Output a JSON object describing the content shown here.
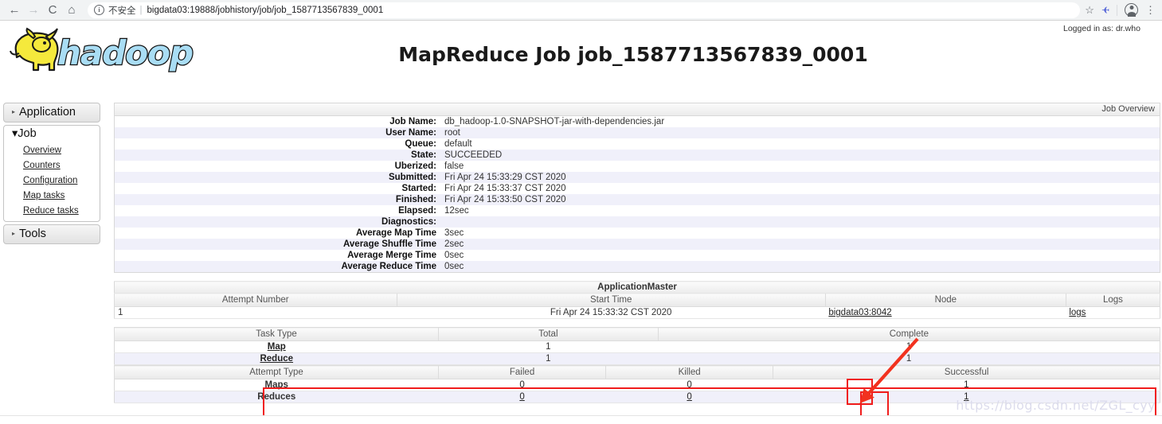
{
  "browser": {
    "back_icon": "←",
    "forward_icon": "→",
    "reload_icon": "C",
    "home_icon": "⌂",
    "security_label": "不安全",
    "separator": "|",
    "url": "bigdata03:19888/jobhistory/job/job_1587713567839_0001",
    "star_icon": "☆",
    "extension_icon": "✈",
    "menu_icon": "⋮"
  },
  "header": {
    "logo_text": "hadoop",
    "page_title": "MapReduce Job job_1587713567839_0001",
    "logged_in": "Logged in as: dr.who"
  },
  "sidebar": {
    "application": {
      "label": "Application",
      "arrow": "▸"
    },
    "job": {
      "label": "Job",
      "arrow": "▾",
      "items": [
        {
          "label": "Overview"
        },
        {
          "label": "Counters"
        },
        {
          "label": "Configuration"
        },
        {
          "label": "Map tasks"
        },
        {
          "label": "Reduce tasks"
        }
      ]
    },
    "tools": {
      "label": "Tools",
      "arrow": "▸"
    }
  },
  "job_overview": {
    "caption": "Job Overview",
    "rows": [
      {
        "key": "Job Name:",
        "value": "db_hadoop-1.0-SNAPSHOT-jar-with-dependencies.jar"
      },
      {
        "key": "User Name:",
        "value": "root"
      },
      {
        "key": "Queue:",
        "value": "default"
      },
      {
        "key": "State:",
        "value": "SUCCEEDED"
      },
      {
        "key": "Uberized:",
        "value": "false"
      },
      {
        "key": "Submitted:",
        "value": "Fri Apr 24 15:33:29 CST 2020"
      },
      {
        "key": "Started:",
        "value": "Fri Apr 24 15:33:37 CST 2020"
      },
      {
        "key": "Finished:",
        "value": "Fri Apr 24 15:33:50 CST 2020"
      },
      {
        "key": "Elapsed:",
        "value": "12sec"
      },
      {
        "key": "Diagnostics:",
        "value": ""
      },
      {
        "key": "Average Map Time",
        "value": "3sec"
      },
      {
        "key": "Average Shuffle Time",
        "value": "2sec"
      },
      {
        "key": "Average Merge Time",
        "value": "0sec"
      },
      {
        "key": "Average Reduce Time",
        "value": "0sec"
      }
    ]
  },
  "application_master": {
    "title": "ApplicationMaster",
    "headers": [
      "Attempt Number",
      "Start Time",
      "Node",
      "Logs"
    ],
    "rows": [
      {
        "attempt_number": "1",
        "start_time": "Fri Apr 24 15:33:32 CST 2020",
        "node": "bigdata03:8042",
        "logs": "logs"
      }
    ]
  },
  "task_summary": {
    "headers": [
      "Task Type",
      "Total",
      "Complete"
    ],
    "rows": [
      {
        "task_type": "Map",
        "total": "1",
        "complete": "1"
      },
      {
        "task_type": "Reduce",
        "total": "1",
        "complete": "1"
      }
    ],
    "attempt_headers": [
      "Attempt Type",
      "Failed",
      "Killed",
      "Successful"
    ],
    "attempt_rows": [
      {
        "attempt_type": "Maps",
        "failed": "0",
        "killed": "0",
        "successful": "1"
      },
      {
        "attempt_type": "Reduces",
        "failed": "0",
        "killed": "0",
        "successful": "1"
      }
    ]
  },
  "annotations": {
    "highlight_color": "#f01c1c",
    "watermark": "https://blog.csdn.net/ZGL_cyy"
  }
}
